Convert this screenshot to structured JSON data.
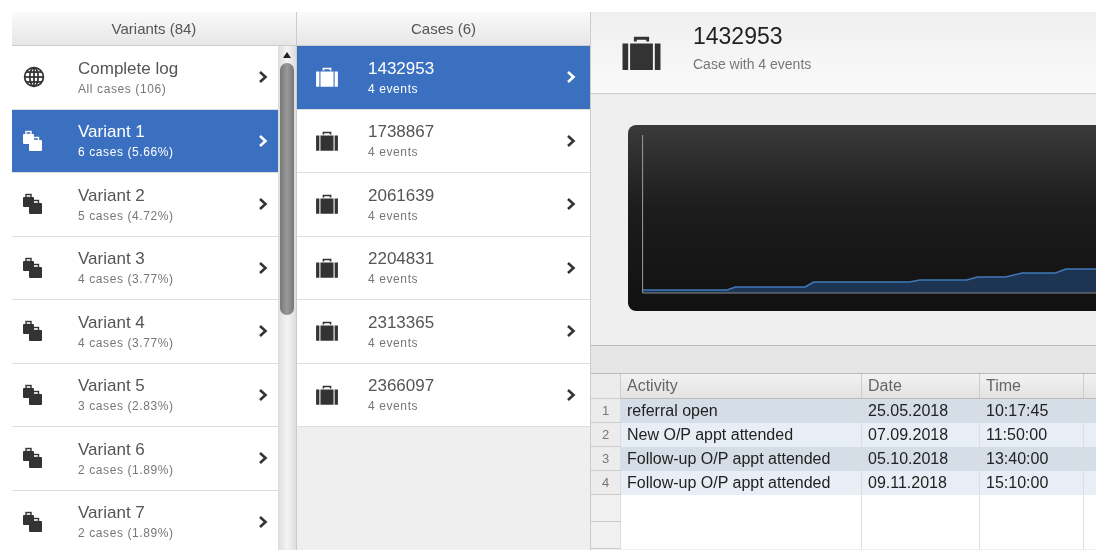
{
  "variants": {
    "header": "Variants (84)",
    "items": [
      {
        "kind": "log",
        "title": "Complete log",
        "subtitle": "All cases (106)",
        "selected": false
      },
      {
        "kind": "variant",
        "title": "Variant 1",
        "subtitle": "6 cases (5.66%)",
        "selected": true
      },
      {
        "kind": "variant",
        "title": "Variant 2",
        "subtitle": "5 cases (4.72%)",
        "selected": false
      },
      {
        "kind": "variant",
        "title": "Variant 3",
        "subtitle": "4 cases (3.77%)",
        "selected": false
      },
      {
        "kind": "variant",
        "title": "Variant 4",
        "subtitle": "4 cases (3.77%)",
        "selected": false
      },
      {
        "kind": "variant",
        "title": "Variant 5",
        "subtitle": "3 cases (2.83%)",
        "selected": false
      },
      {
        "kind": "variant",
        "title": "Variant 6",
        "subtitle": "2 cases (1.89%)",
        "selected": false
      },
      {
        "kind": "variant",
        "title": "Variant 7",
        "subtitle": "2 cases (1.89%)",
        "selected": false
      }
    ]
  },
  "cases": {
    "header": "Cases (6)",
    "items": [
      {
        "title": "1432953",
        "subtitle": "4 events",
        "selected": true
      },
      {
        "title": "1738867",
        "subtitle": "4 events",
        "selected": false
      },
      {
        "title": "2061639",
        "subtitle": "4 events",
        "selected": false
      },
      {
        "title": "2204831",
        "subtitle": "4 events",
        "selected": false
      },
      {
        "title": "2313365",
        "subtitle": "4 events",
        "selected": false
      },
      {
        "title": "2366097",
        "subtitle": "4 events",
        "selected": false
      }
    ]
  },
  "detail": {
    "title": "1432953",
    "subtitle": "Case with 4 events",
    "table": {
      "columns": [
        "Activity",
        "Date",
        "Time"
      ],
      "rows": [
        {
          "index": "1",
          "activity": "referral open",
          "date": "25.05.2018",
          "time": "10:17:45"
        },
        {
          "index": "2",
          "activity": "New O/P appt attended",
          "date": "07.09.2018",
          "time": "11:50:00"
        },
        {
          "index": "3",
          "activity": "Follow-up O/P appt attended",
          "date": "05.10.2018",
          "time": "13:40:00"
        },
        {
          "index": "4",
          "activity": "Follow-up O/P appt attended",
          "date": "09.11.2018",
          "time": "15:10:00"
        }
      ]
    }
  }
}
